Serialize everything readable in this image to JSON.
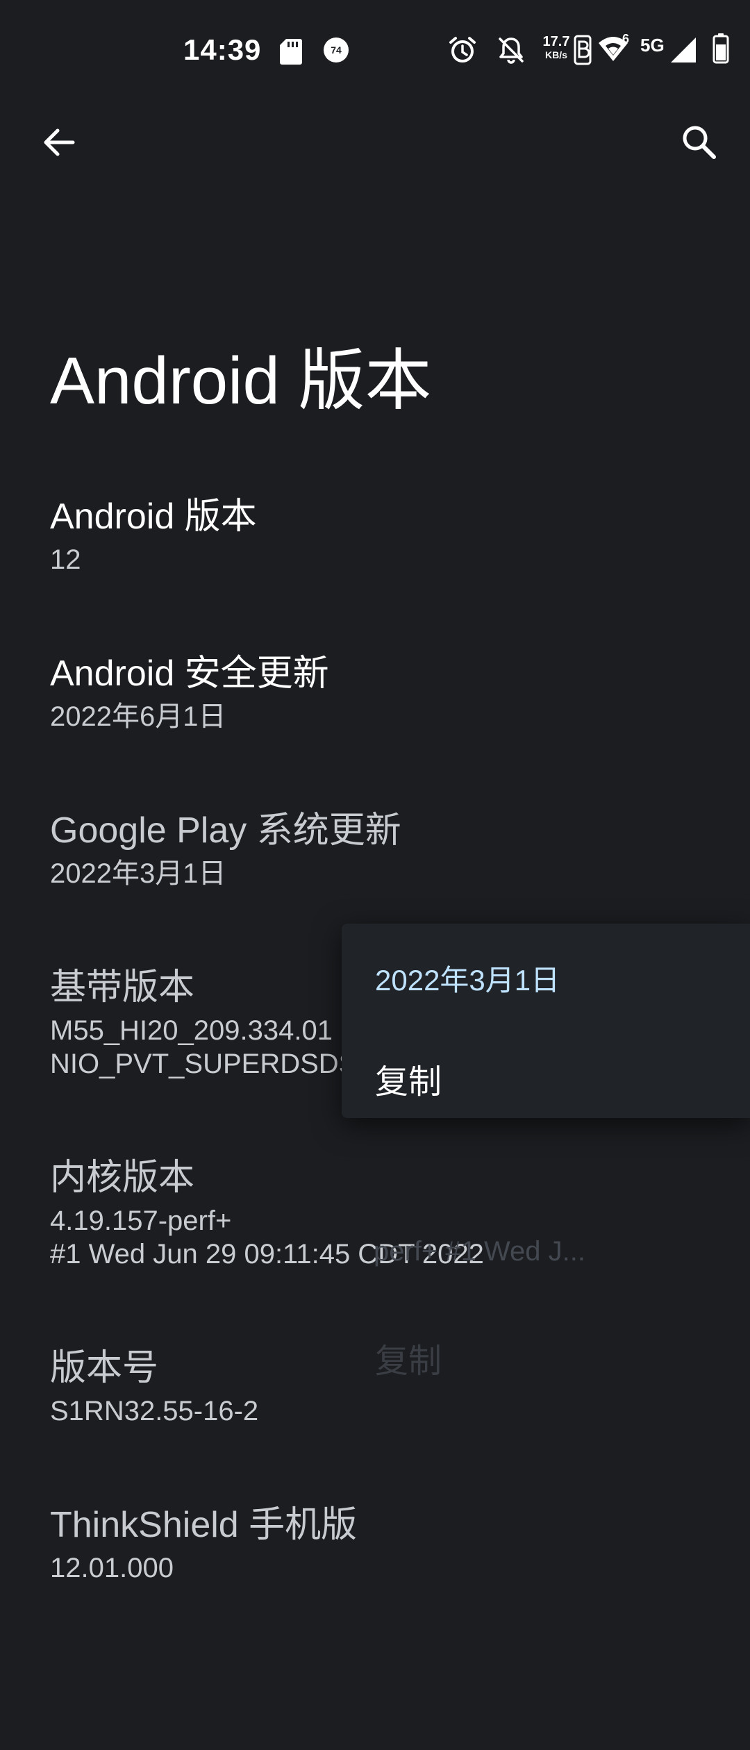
{
  "status_bar": {
    "time": "14:39",
    "net_speed_value": "17.7",
    "net_speed_unit": "KB/s",
    "network": "5G",
    "notif_badge": "74",
    "wifi_badge": "6"
  },
  "page": {
    "title": "Android 版本"
  },
  "items": [
    {
      "title": "Android 版本",
      "summary": "12"
    },
    {
      "title": "Android 安全更新",
      "summary": "2022年6月1日"
    },
    {
      "title": "Google Play 系统更新",
      "summary": "2022年3月1日"
    },
    {
      "title": "基带版本",
      "summary": "M55_HI20_209.334.01\nNIO_PVT_SUPERDSDS"
    },
    {
      "title": "内核版本",
      "summary": "4.19.157-perf+\n#1 Wed Jun 29 09:11:45 CDT 2022"
    },
    {
      "title": "版本号",
      "summary": "S1RN32.55-16-2"
    },
    {
      "title": "ThinkShield 手机版",
      "summary": "12.01.000"
    }
  ],
  "background_menu": {
    "text": "perf+ #1 Wed J...",
    "copy_label": "复制"
  },
  "popup": {
    "title": "2022年3月1日",
    "copy_label": "复制"
  }
}
